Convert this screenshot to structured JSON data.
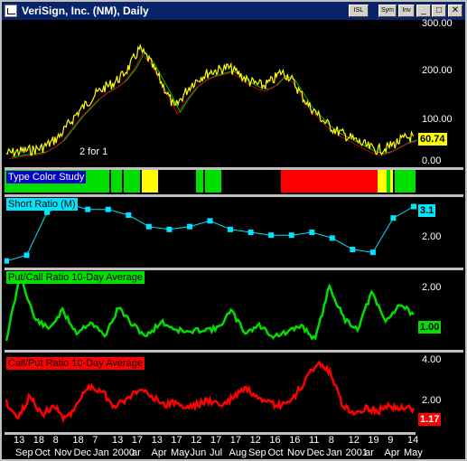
{
  "window": {
    "title": "VeriSign, Inc. (NM), Daily",
    "buttons": {
      "isl": "ISL",
      "sym": "Sym",
      "inv": "Inv",
      "min": "_",
      "max": "□",
      "close": "✕"
    }
  },
  "colors": {
    "price": "#ffff00",
    "ma_green": "#00c000",
    "ma_red": "#c00000",
    "short_ratio": "#00e5ff",
    "put_call": "#00e000",
    "call_put": "#ff0000",
    "study_green": "#00e000",
    "study_yellow": "#ffff00",
    "study_red": "#ff0000"
  },
  "annotation": "2 for 1",
  "panes": {
    "price": {
      "last_value": "60.74",
      "ticks": [
        "300.00",
        "200.00",
        "100.00",
        "0.00"
      ]
    },
    "type_color": {
      "label": "Type Color Study"
    },
    "short_ratio": {
      "label": "Short Ratio (M)",
      "last_value": "3.1",
      "ticks": [
        "2.00"
      ]
    },
    "put_call": {
      "label": "Put/Call Ratio 10-Day Average",
      "last_value": "1.00",
      "ticks": [
        "2.00",
        "1.00"
      ]
    },
    "call_put": {
      "label": "Call/Put Ratio 10-Day Average",
      "last_value": "1.17",
      "ticks": [
        "4.00",
        "2.00"
      ]
    }
  },
  "x_axis": {
    "days": [
      "13",
      "18",
      "8",
      "18",
      "7",
      "13",
      "17",
      "13",
      "17",
      "12",
      "17",
      "17",
      "12",
      "16",
      "16",
      "11",
      "8",
      "12",
      "19",
      "9",
      "14"
    ],
    "months": [
      "Sep",
      "Oct",
      "Nov",
      "Dec",
      "Jan",
      "2000",
      "ar",
      "Apr",
      "May",
      "Jun",
      "Jul",
      "Aug",
      "Sep",
      "Oct",
      "Nov",
      "Dec",
      "Jan",
      "2001",
      "ar",
      "Apr",
      "May"
    ]
  },
  "chart_data": [
    {
      "type": "line",
      "title": "VeriSign, Inc. (NM), Daily",
      "ylim": [
        0,
        300
      ],
      "series": [
        {
          "values": [
            22,
            25,
            28,
            30,
            34,
            45,
            60,
            85,
            110,
            130,
            150,
            165,
            175,
            190,
            215,
            250,
            230,
            195,
            160,
            120,
            150,
            175,
            190,
            200,
            205,
            210,
            200,
            185,
            175,
            170,
            180,
            200,
            190,
            160,
            130,
            110,
            90,
            75,
            65,
            55,
            45,
            35,
            30,
            35,
            45,
            55,
            60
          ]
        }
      ]
    },
    {
      "type": "line",
      "title": "Short Ratio (M)",
      "series": [
        {
          "name": "Short Ratio (M)",
          "values": [
            1.2,
            1.4,
            2.9,
            3.2,
            3.0,
            3.0,
            2.8,
            2.4,
            2.3,
            2.4,
            2.6,
            2.3,
            2.2,
            2.1,
            2.1,
            2.2,
            2.0,
            1.6,
            1.5,
            2.7,
            3.1
          ]
        }
      ]
    },
    {
      "type": "line",
      "title": "Put/Call Ratio 10-Day Average",
      "ylim": [
        0,
        2.2
      ],
      "series": [
        {
          "name": "Put/Call Ratio 10-Day Average",
          "values": [
            0.3,
            2.1,
            0.9,
            0.6,
            1.1,
            0.5,
            0.8,
            0.4,
            1.2,
            0.7,
            0.4,
            0.8,
            0.6,
            0.5,
            0.6,
            0.6,
            1.1,
            0.5,
            0.7,
            0.4,
            0.5,
            0.7,
            0.3,
            1.8,
            0.9,
            0.6,
            1.6,
            0.8,
            1.3,
            1.0
          ]
        }
      ]
    },
    {
      "type": "line",
      "title": "Call/Put Ratio 10-Day Average",
      "ylim": [
        0,
        4.2
      ],
      "series": [
        {
          "name": "Call/Put Ratio 10-Day Average",
          "values": [
            1.5,
            0.6,
            1.9,
            0.8,
            1.3,
            0.5,
            1.6,
            2.4,
            2.1,
            1.3,
            1.6,
            2.2,
            2.0,
            1.3,
            1.5,
            1.2,
            1.4,
            1.6,
            1.3,
            1.8,
            2.3,
            1.6,
            1.4,
            1.3,
            1.7,
            2.8,
            3.7,
            3.2,
            1.4,
            0.9,
            1.2,
            1.0,
            1.3,
            1.2,
            1.17
          ]
        }
      ]
    }
  ]
}
